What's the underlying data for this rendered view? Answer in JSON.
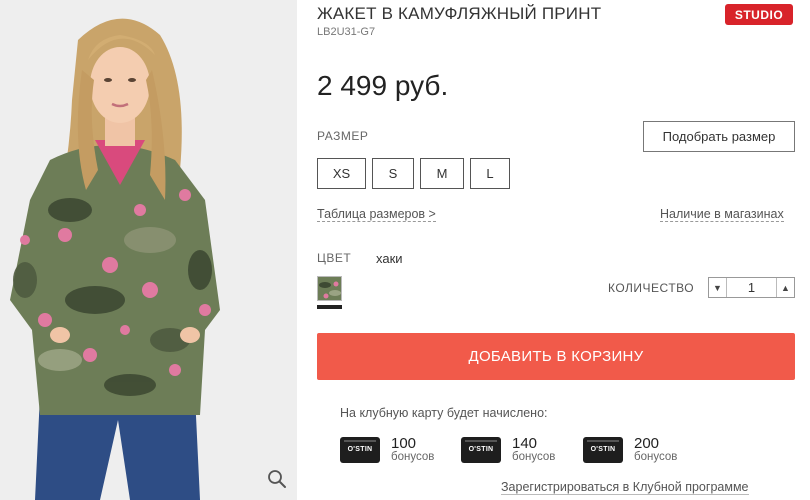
{
  "product": {
    "title": "ЖАКЕТ В КАМУФЛЯЖНЫЙ ПРИНТ",
    "sku": "LB2U31-G7",
    "badge": "STUDIO",
    "price": "2 499 руб."
  },
  "size": {
    "label": "РАЗМЕР",
    "find_button": "Подобрать размер",
    "options": [
      "XS",
      "S",
      "M",
      "L"
    ],
    "table_link": "Таблица размеров >",
    "stores_link": "Наличие в магазинах"
  },
  "color": {
    "label": "ЦВЕТ",
    "value": "хаки"
  },
  "quantity": {
    "label": "КОЛИЧЕСТВО",
    "value": "1"
  },
  "cart": {
    "add_label": "ДОБАВИТЬ В КОРЗИНУ"
  },
  "bonus": {
    "caption": "На клубную карту будет начислено:",
    "card_brand": "O'STIN",
    "unit": "бонусов",
    "amounts": [
      "100",
      "140",
      "200"
    ],
    "register_link": "Зарегистрироваться в Клубной программе"
  },
  "colors": {
    "accent": "#f15a4a",
    "badge": "#d8232a"
  },
  "icons": {
    "zoom": "magnifier-icon",
    "qty_down": "triangle-down-icon",
    "qty_up": "triangle-up-icon"
  }
}
